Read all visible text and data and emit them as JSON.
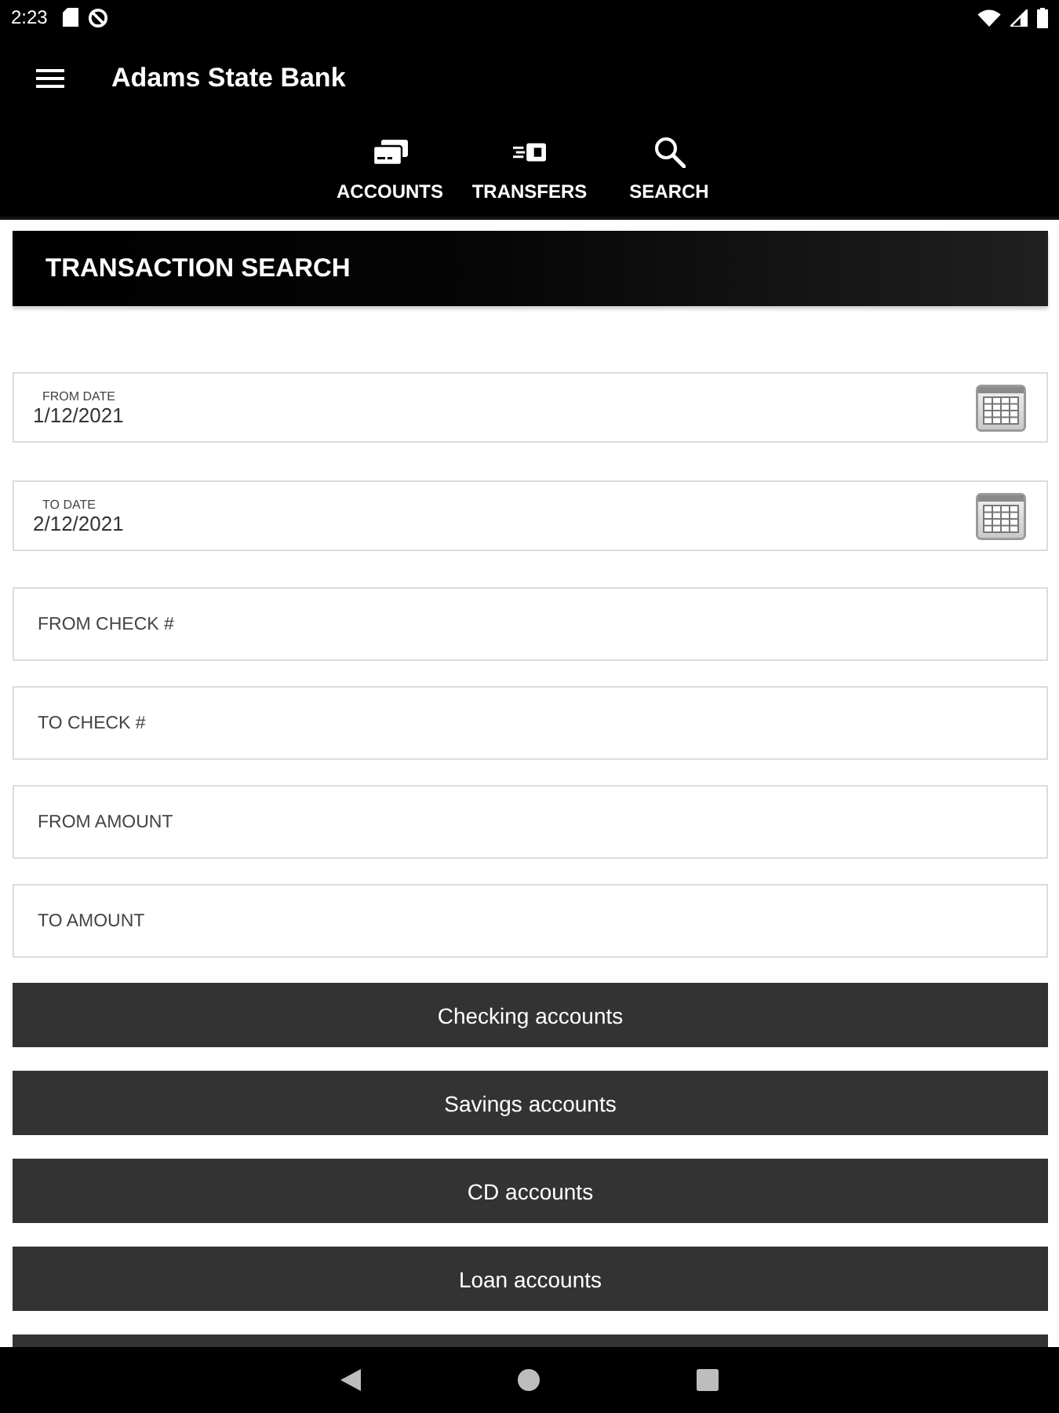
{
  "status_bar": {
    "time": "2:23"
  },
  "app_bar": {
    "title": "Adams State Bank"
  },
  "nav_tabs": [
    {
      "label": "ACCOUNTS",
      "kind": "accounts"
    },
    {
      "label": "TRANSFERS",
      "kind": "transfers"
    },
    {
      "label": "SEARCH",
      "kind": "search"
    }
  ],
  "section_title": "TRANSACTION SEARCH",
  "date_fields": [
    {
      "label": "FROM DATE",
      "value": "1/12/2021"
    },
    {
      "label": "TO DATE",
      "value": "2/12/2021"
    }
  ],
  "text_fields": [
    {
      "placeholder": "FROM CHECK #"
    },
    {
      "placeholder": "TO CHECK #"
    },
    {
      "placeholder": "FROM AMOUNT"
    },
    {
      "placeholder": "TO AMOUNT"
    }
  ],
  "account_buttons": [
    "Checking accounts",
    "Savings accounts",
    "CD accounts",
    "Loan accounts"
  ]
}
